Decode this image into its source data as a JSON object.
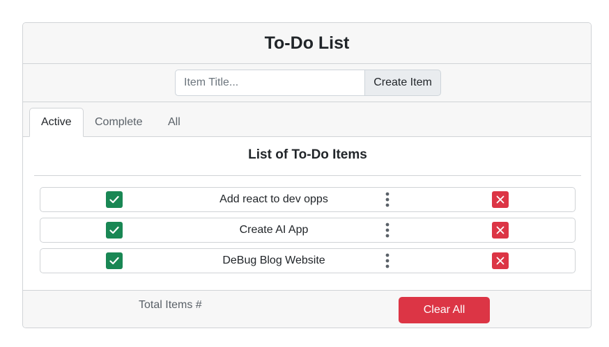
{
  "app": {
    "title": "To-Do List"
  },
  "new_item": {
    "placeholder": "Item Title...",
    "value": "",
    "create_label": "Create Item"
  },
  "tabs": [
    {
      "label": "Active",
      "selected": true
    },
    {
      "label": "Complete",
      "selected": false
    },
    {
      "label": "All",
      "selected": false
    }
  ],
  "list": {
    "heading": "List of To-Do Items",
    "items": [
      {
        "title": "Add react to dev opps"
      },
      {
        "title": "Create AI App"
      },
      {
        "title": "DeBug Blog Website"
      }
    ]
  },
  "footer": {
    "total_label": "Total Items #",
    "clear_label": "Clear All"
  },
  "icons": {
    "complete": "check-square-icon",
    "menu": "vertical-ellipsis-icon",
    "delete": "x-square-icon"
  },
  "colors": {
    "success": "#198754",
    "danger": "#dc3545",
    "muted": "#5a6168",
    "panel": "#f7f7f7"
  }
}
